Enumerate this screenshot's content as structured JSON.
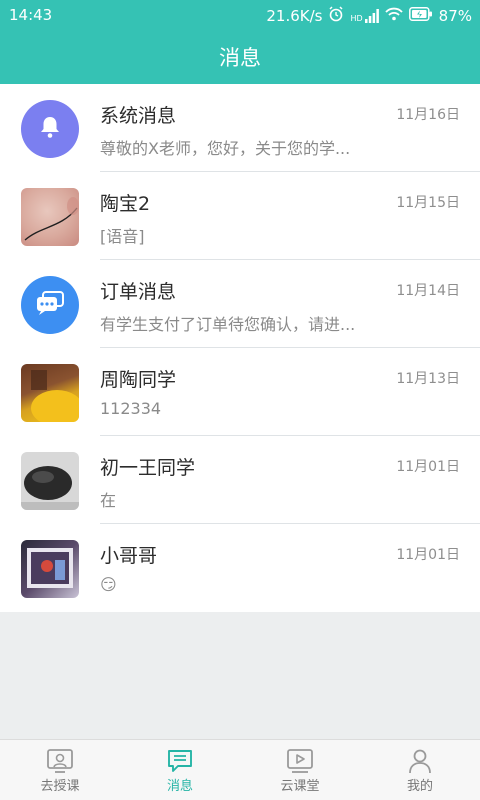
{
  "status_bar": {
    "time": "14:43",
    "speed": "21.6K/s",
    "signal": "HD",
    "battery": "87%"
  },
  "header": {
    "title": "消息"
  },
  "messages": [
    {
      "name": "系统消息",
      "date": "11月16日",
      "preview": "尊敬的X老师，您好，关于您的学...",
      "avatar_icon": "bell-icon",
      "avatar_color": "#7b7ff0"
    },
    {
      "name": "陶宝2",
      "date": "11月15日",
      "preview": "[语音]",
      "avatar_icon": "photo"
    },
    {
      "name": "订单消息",
      "date": "11月14日",
      "preview": "有学生支付了订单待您确认，请进...",
      "avatar_icon": "chat-icon",
      "avatar_color": "#3d8ff2"
    },
    {
      "name": "周陶同学",
      "date": "11月13日",
      "preview": "112334",
      "avatar_icon": "photo"
    },
    {
      "name": "初一王同学",
      "date": "11月01日",
      "preview": "在",
      "avatar_icon": "photo"
    },
    {
      "name": "小哥哥",
      "date": "11月01日",
      "preview": "😏",
      "avatar_icon": "photo"
    }
  ],
  "tabs": [
    {
      "label": "去授课",
      "icon": "teach-icon",
      "active": false
    },
    {
      "label": "消息",
      "icon": "message-icon",
      "active": true
    },
    {
      "label": "云课堂",
      "icon": "video-icon",
      "active": false
    },
    {
      "label": "我的",
      "icon": "person-icon",
      "active": false
    }
  ],
  "colors": {
    "accent": "#35c2b4",
    "active_tab": "#26b4a6"
  }
}
